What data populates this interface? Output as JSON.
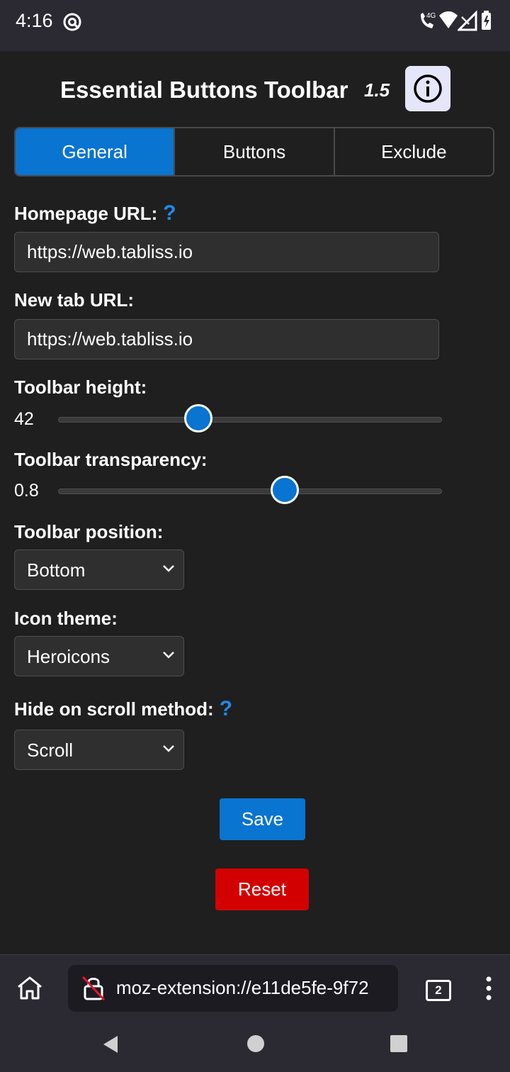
{
  "status_bar": {
    "time": "4:16",
    "network_label": "4G"
  },
  "header": {
    "title": "Essential Buttons Toolbar",
    "version": "1.5"
  },
  "tabs": [
    {
      "label": "General",
      "active": true
    },
    {
      "label": "Buttons",
      "active": false
    },
    {
      "label": "Exclude",
      "active": false
    }
  ],
  "form": {
    "homepage_url": {
      "label": "Homepage URL:",
      "help": "?",
      "value": "https://web.tabliss.io"
    },
    "new_tab_url": {
      "label": "New tab URL:",
      "value": "https://web.tabliss.io"
    },
    "toolbar_height": {
      "label": "Toolbar height:",
      "value": "42",
      "fraction": 0.365
    },
    "toolbar_transparency": {
      "label": "Toolbar transparency:",
      "value": "0.8",
      "fraction": 0.59
    },
    "toolbar_position": {
      "label": "Toolbar position:",
      "value": "Bottom"
    },
    "icon_theme": {
      "label": "Icon theme:",
      "value": "Heroicons"
    },
    "hide_on_scroll": {
      "label": "Hide on scroll method:",
      "help": "?",
      "value": "Scroll"
    }
  },
  "actions": {
    "save_label": "Save",
    "reset_label": "Reset"
  },
  "browser": {
    "url": "moz-extension://e11de5fe-9f72",
    "tab_count": "2"
  },
  "colors": {
    "accent": "#0a74d1",
    "danger": "#d30000",
    "background": "#1f1f1f"
  }
}
